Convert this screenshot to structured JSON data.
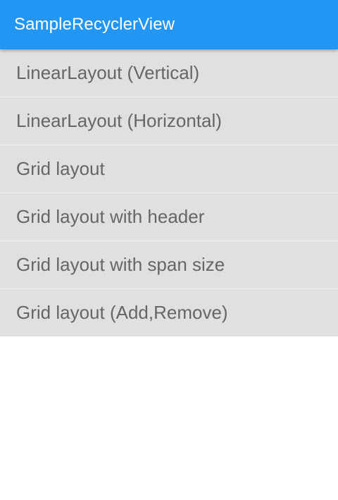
{
  "app_bar": {
    "title": "SampleRecyclerView",
    "color": "#2196f3"
  },
  "list": {
    "items": [
      {
        "label": "LinearLayout (Vertical)"
      },
      {
        "label": "LinearLayout (Horizontal)"
      },
      {
        "label": "Grid layout"
      },
      {
        "label": "Grid layout with header"
      },
      {
        "label": "Grid layout with span size"
      },
      {
        "label": "Grid layout (Add,Remove)"
      }
    ],
    "item_background": "#e0e0e0",
    "text_color": "#666666"
  }
}
